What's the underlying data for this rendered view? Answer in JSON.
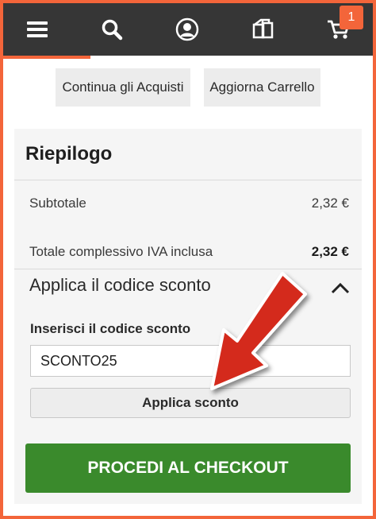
{
  "nav": {
    "icons": [
      "menu-icon",
      "search-icon",
      "account-icon",
      "compare-icon",
      "cart-icon"
    ],
    "cart_count": "1"
  },
  "actions": {
    "continue_shopping": "Continua gli Acquisti",
    "update_cart": "Aggiorna Carrello"
  },
  "summary": {
    "title": "Riepilogo",
    "subtotal_label": "Subtotale",
    "subtotal_value": "2,32 €",
    "total_label": "Totale complessivo IVA inclusa",
    "total_value": "2,32 €"
  },
  "coupon": {
    "heading": "Applica il codice sconto",
    "field_label": "Inserisci il codice sconto",
    "field_value": "SCONTO25",
    "apply_label": "Applica sconto"
  },
  "checkout": {
    "label": "PROCEDI AL CHECKOUT"
  },
  "colors": {
    "border": "#f3653a",
    "topbar": "#363636",
    "checkout": "#3a8a2c",
    "arrow": "#d42a1e"
  }
}
